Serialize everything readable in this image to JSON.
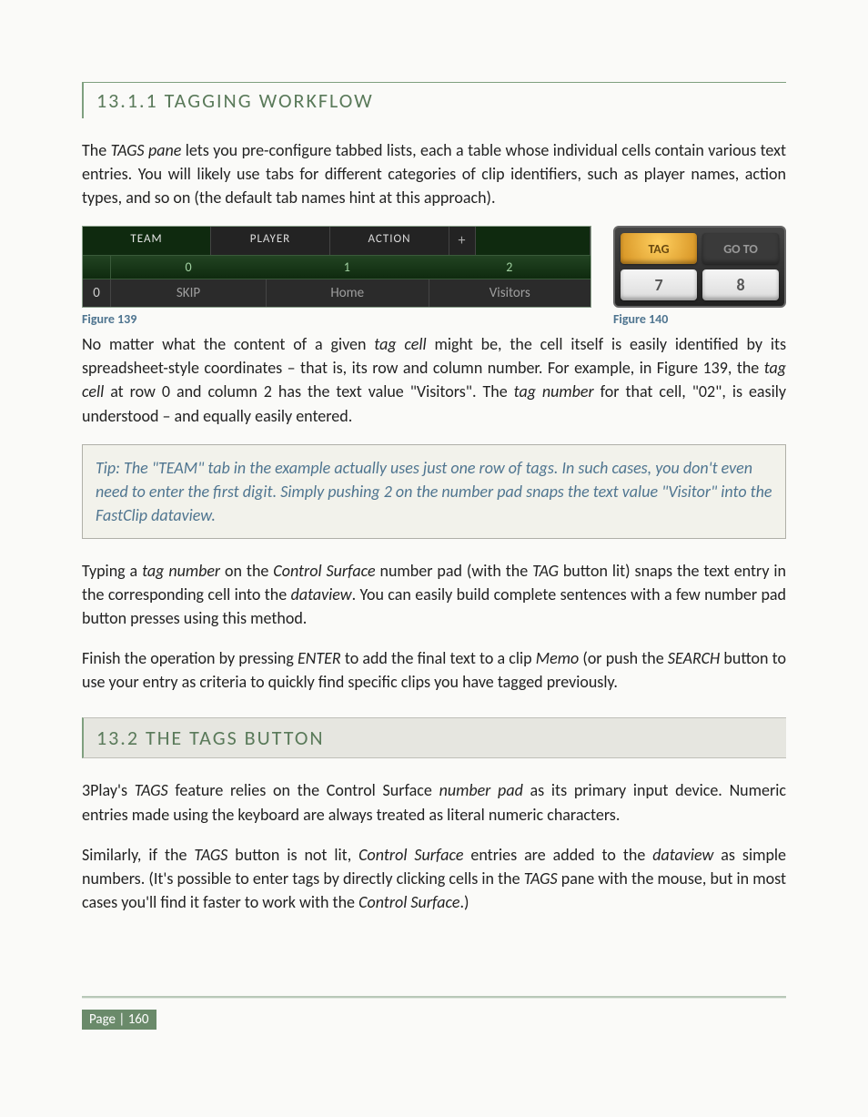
{
  "section1": {
    "heading": "13.1.1 TAGGING WORKFLOW",
    "para1_parts": [
      "The ",
      "TAGS pane",
      " lets you pre-configure tabbed lists, each a table whose individual cells contain various text entries.  You will likely use tabs for different categories of clip identifiers, such as player names, action types, and so on (the default tab names hint at this approach)."
    ]
  },
  "fig139": {
    "tabs": {
      "team": "TEAM",
      "player": "PLAYER",
      "action": "ACTION",
      "plus": "+"
    },
    "headers": {
      "c0": "0",
      "c1": "1",
      "c2": "2"
    },
    "row0": {
      "num": "0",
      "c0": "SKIP",
      "c1": "Home",
      "c2": "Visitors"
    },
    "caption": "Figure 139"
  },
  "fig140": {
    "keys": {
      "tag": "TAG",
      "goto": "GO TO",
      "seven": "7",
      "eight": "8"
    },
    "caption": "Figure 140"
  },
  "para2_parts": [
    "No matter what the content of a given ",
    "tag cell",
    " might be, the cell itself is easily identified by its spreadsheet-style coordinates – that is, its row and column number.  For example, in Figure 139, the ",
    "tag cell",
    " at row 0 and column 2 has the text value \"Visitors\". The ",
    "tag number",
    " for that cell, \"02\", is easily understood – and equally easily entered."
  ],
  "tip": "Tip: The \"TEAM\" tab in the example actually uses just one row of tags.  In such cases, you don't even need to enter the first digit. Simply pushing 2 on the number pad snaps the text value \"Visitor\" into the FastClip dataview.",
  "para3_parts": [
    "Typing a ",
    "tag number",
    " on the ",
    "Control Surface",
    " number pad (with the ",
    "TAG",
    " button lit) snaps the text entry in the corresponding cell into the ",
    "dataview",
    ".  You can easily build complete sentences with a few number pad button presses using this method."
  ],
  "para4_parts": [
    "Finish the operation by pressing ",
    "ENTER",
    " to add the final text to a clip ",
    "Memo",
    " (or push the ",
    "SEARCH",
    " button to use your entry as criteria to quickly find specific clips you have tagged previously."
  ],
  "section2": {
    "heading": "13.2  THE TAGS BUTTON",
    "para1_parts": [
      "3Play's ",
      "TAGS",
      " feature relies on the Control Surface ",
      "number pad",
      " as its primary input device.  Numeric entries made using the keyboard are always treated as literal numeric characters."
    ],
    "para2_parts": [
      "Similarly, if the ",
      "TAGS",
      " button is not lit, ",
      "Control Surface",
      " entries are added to the ",
      "dataview",
      " as simple numbers.  (It's possible to enter tags by directly clicking cells in the ",
      "TAGS",
      " pane with the mouse, but in most cases you'll find it faster to work with the ",
      "Control Surface",
      ".)"
    ]
  },
  "footer": {
    "page": "Page | 160"
  }
}
